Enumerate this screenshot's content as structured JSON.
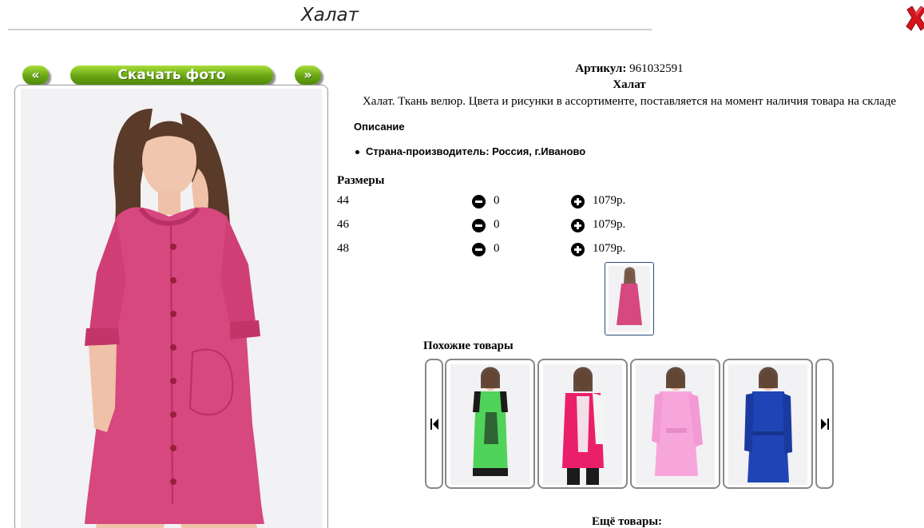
{
  "page": {
    "title": "Халат"
  },
  "gallery": {
    "prev_label": "«",
    "download_label": "Скачать фото",
    "next_label": "»"
  },
  "product": {
    "article_label": "Артикул:",
    "article_value": "961032591",
    "name": "Халат",
    "description": "Халат. Ткань велюр. Цвета и рисунки в ассортименте, поставляется на момент наличия товара на складе",
    "section_title": "Описание",
    "features": [
      "Страна-производитель: Россия, г.Иваново"
    ]
  },
  "sizes": {
    "heading": "Размеры",
    "rows": [
      {
        "size": "44",
        "qty": "0",
        "price": "1079р."
      },
      {
        "size": "46",
        "qty": "0",
        "price": "1079р."
      },
      {
        "size": "48",
        "qty": "0",
        "price": "1079р."
      }
    ]
  },
  "similar": {
    "heading": "Похожие товары",
    "items": [
      {
        "color": "#4fd35a",
        "accent": "#1b1b1b"
      },
      {
        "color": "#ea1f6a",
        "accent": "#f4f4f4"
      },
      {
        "color": "#f7a6dc",
        "accent": "#f7a6dc"
      },
      {
        "color": "#1f44b5",
        "accent": "#1f44b5"
      }
    ]
  },
  "more": {
    "heading": "Ещё товары:"
  },
  "colors": {
    "accent_green": "#6aa514",
    "close_red": "#d4141c",
    "robe_pink": "#d6487e"
  }
}
